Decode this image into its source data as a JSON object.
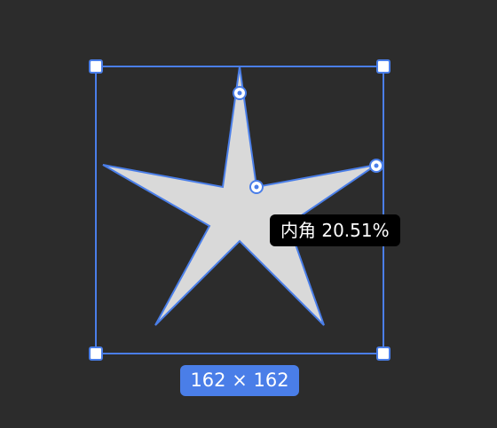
{
  "canvas": {
    "background_color": "#2c2c2c"
  },
  "shape": {
    "type": "star",
    "points": 5,
    "fill_color": "#d9d9d9",
    "stroke_color": "#4a7ee8"
  },
  "selection": {
    "color": "#4a7ee8",
    "handle_fill": "#ffffff"
  },
  "tooltip": {
    "label": "内角",
    "value": "20.51%",
    "text": "内角 20.51%",
    "background": "#000000"
  },
  "dimensions_badge": {
    "text": "162 × 162",
    "background": "#4a7ee8"
  },
  "icons": {
    "corner_handle": "square-resize-handle-icon",
    "control_point": "circle-control-point-icon"
  }
}
